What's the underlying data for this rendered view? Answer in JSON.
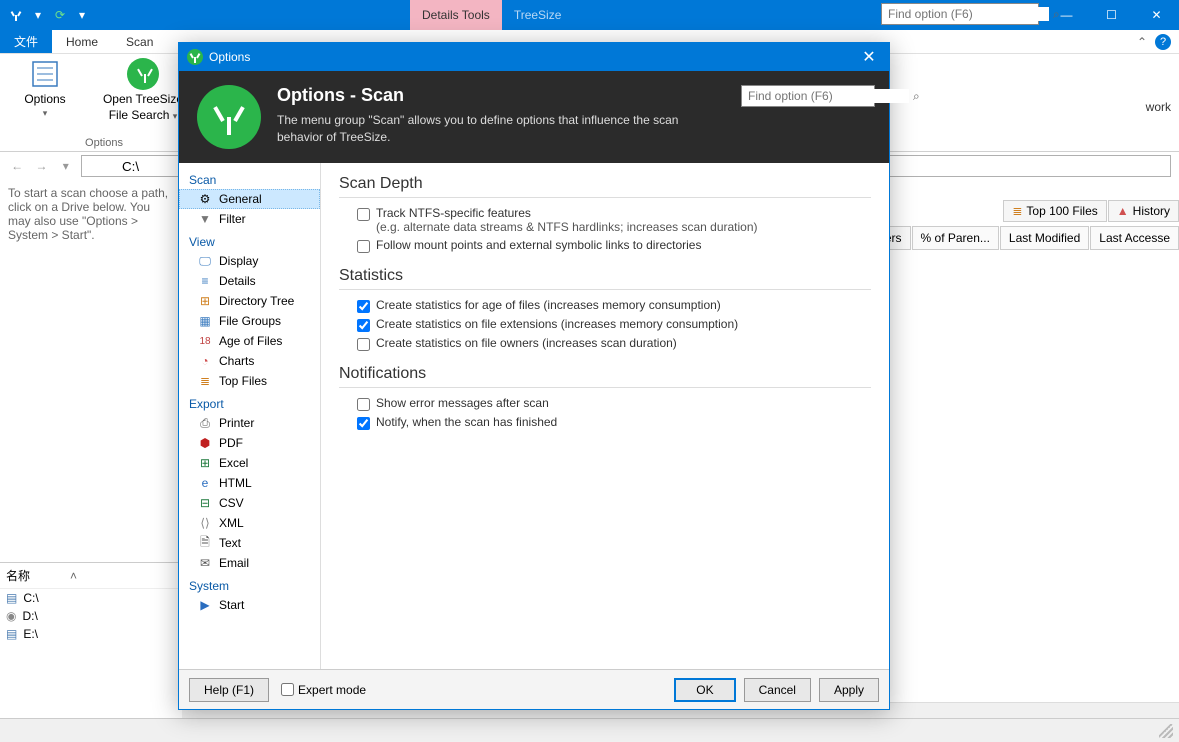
{
  "main_window": {
    "contextual_tab": "Details Tools",
    "app_title": "TreeSize",
    "search_placeholder": "Find option (F6)",
    "ribbon_tabs": {
      "file": "文件",
      "home": "Home",
      "scan": "Scan"
    },
    "ribbon": {
      "options_btn": "Options",
      "open_search_line1": "Open TreeSize",
      "open_search_line2": "File Search",
      "group_label": "Options",
      "network_btn": "work"
    },
    "path": "C:\\",
    "hint": "To start a scan choose a path, click on a Drive below. You may also use \"Options > System > Start\".",
    "right_tabs": {
      "top100": "Top 100 Files",
      "history": "History"
    },
    "columns": {
      "c1": "ers",
      "c2": "% of Paren...",
      "c3": "Last Modified",
      "c4": "Last Accesse"
    },
    "drives_header": "名称",
    "drives": [
      {
        "label": "C:\\"
      },
      {
        "label": "D:\\"
      },
      {
        "label": "E:\\"
      }
    ]
  },
  "dialog": {
    "title": "Options",
    "header_title": "Options - Scan",
    "header_desc": "The menu group \"Scan\" allows you to define options that influence the scan behavior of TreeSize.",
    "search_placeholder": "Find option (F6)",
    "nav": {
      "scan": {
        "header": "Scan",
        "items": [
          "General",
          "Filter"
        ]
      },
      "view": {
        "header": "View",
        "items": [
          "Display",
          "Details",
          "Directory Tree",
          "File Groups",
          "Age of Files",
          "Charts",
          "Top Files"
        ]
      },
      "export": {
        "header": "Export",
        "items": [
          "Printer",
          "PDF",
          "Excel",
          "HTML",
          "CSV",
          "XML",
          "Text",
          "Email"
        ]
      },
      "system": {
        "header": "System",
        "items": [
          "Start"
        ]
      }
    },
    "sections": {
      "scan_depth": {
        "title": "Scan Depth",
        "opt1_line1": "Track NTFS-specific features",
        "opt1_line2": "(e.g. alternate data streams & NTFS hardlinks; increases scan duration)",
        "opt2": "Follow mount points and external symbolic links to directories"
      },
      "statistics": {
        "title": "Statistics",
        "opt1": "Create statistics for age of files (increases memory consumption)",
        "opt2": "Create statistics on file extensions (increases memory consumption)",
        "opt3": "Create statistics on file owners (increases scan duration)"
      },
      "notifications": {
        "title": "Notifications",
        "opt1": "Show error messages after scan",
        "opt2": "Notify, when the scan has finished"
      }
    },
    "footer": {
      "help": "Help (F1)",
      "expert": "Expert mode",
      "ok": "OK",
      "cancel": "Cancel",
      "apply": "Apply"
    }
  }
}
